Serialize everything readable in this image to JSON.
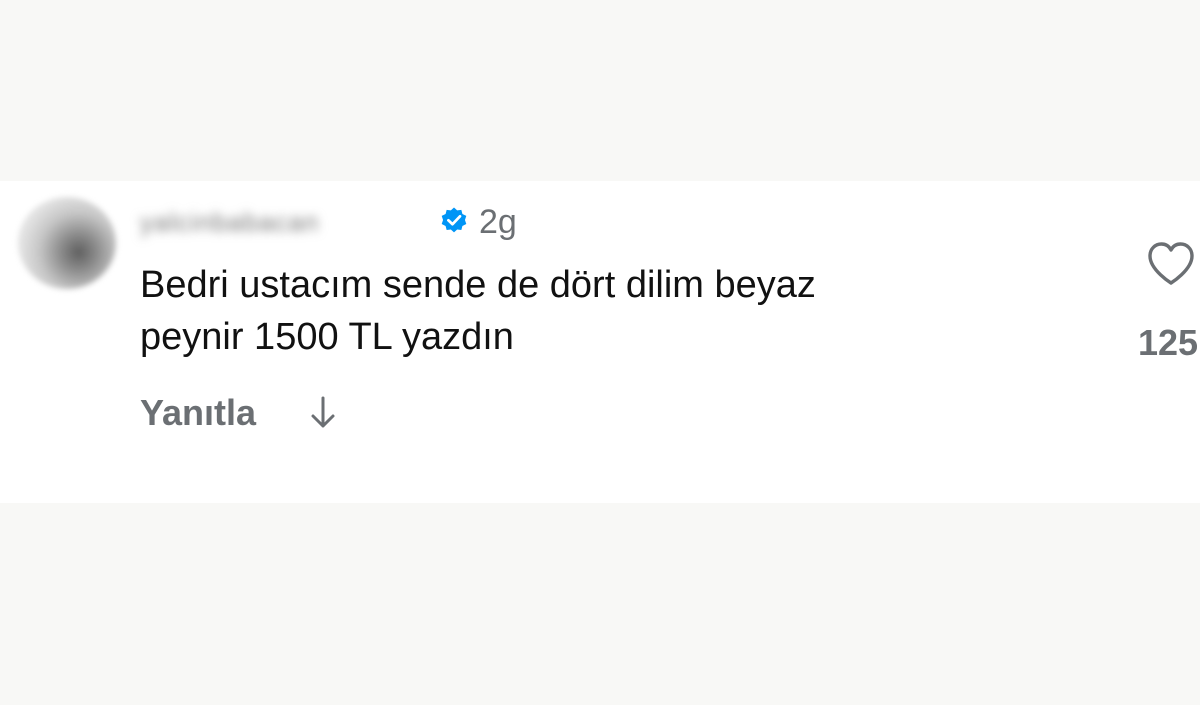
{
  "comment": {
    "username": "yalcinbabacan",
    "verified_icon": "verified-badge-icon",
    "time_ago": "2g",
    "text_line1": "Bedri ustacım sende de dört dilim beyaz",
    "text_line2": "peynir 1500 TL yazdın",
    "reply_label": "Yanıtla",
    "expand_icon": "down-arrow-icon",
    "like_icon": "heart-icon",
    "like_count": "125"
  },
  "colors": {
    "verified": "#0095f6",
    "secondary_text": "#6b6f73",
    "primary_text": "#111111"
  }
}
